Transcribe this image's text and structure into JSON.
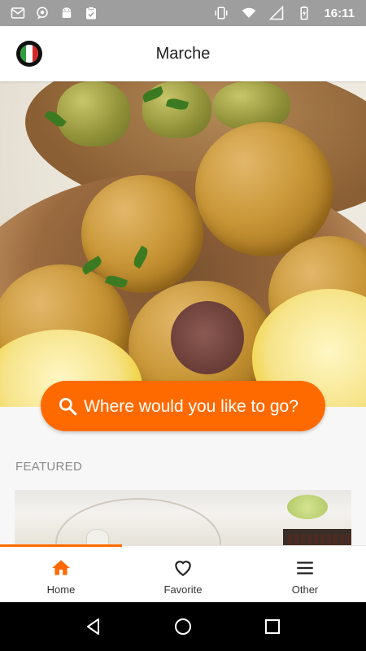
{
  "status_bar": {
    "time": "16:11",
    "left_icons": [
      "gmail-icon",
      "chat-icon",
      "android-icon",
      "clipboard-icon"
    ],
    "right_icons": [
      "vibrate-icon",
      "wifi-icon",
      "signal-icon",
      "battery-charging-icon"
    ]
  },
  "app_bar": {
    "title": "Marche",
    "logo_icon": "italy-flag-logo-icon"
  },
  "hero": {
    "image": "fried-stuffed-olives-photo"
  },
  "search": {
    "label": "Where would you like to go?",
    "icon": "search-icon",
    "color": "#ff6a00"
  },
  "featured": {
    "label": "FEATURED",
    "card_image": "shop-interior-photo"
  },
  "bottom_nav": {
    "active": "Home",
    "accent": "#ff6a00",
    "items": [
      {
        "label": "Home",
        "icon": "home-icon"
      },
      {
        "label": "Favorite",
        "icon": "heart-icon"
      },
      {
        "label": "Other",
        "icon": "menu-icon"
      }
    ]
  },
  "system_nav": [
    "back-icon",
    "home-circle-icon",
    "recents-icon"
  ]
}
